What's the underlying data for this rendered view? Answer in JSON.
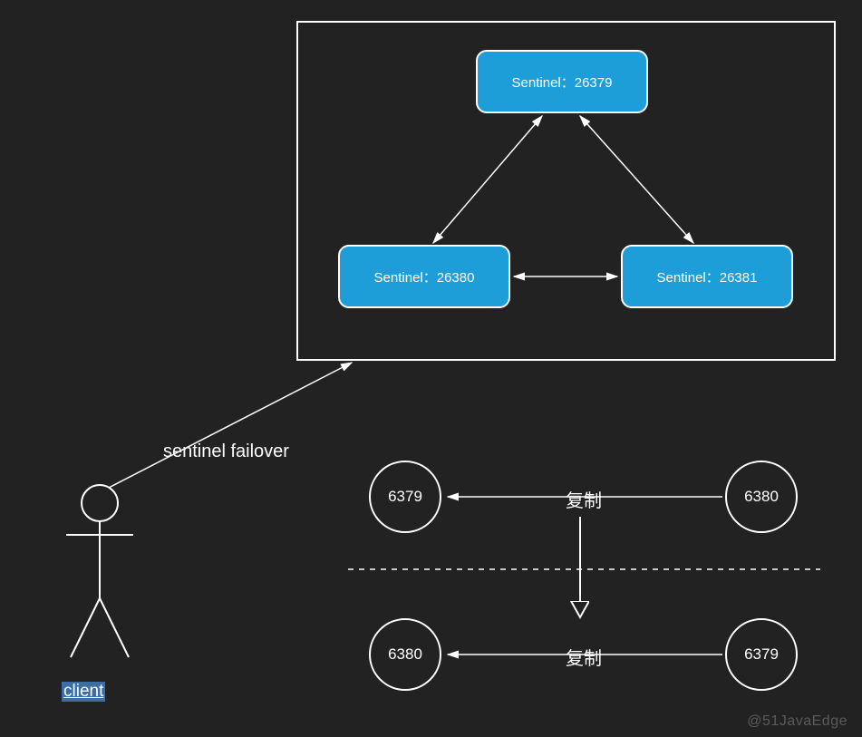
{
  "diagram": {
    "cluster_label": "",
    "sentinels": {
      "top": "Sentinel：26379",
      "left": "Sentinel：26380",
      "right": "Sentinel：26381"
    },
    "failover_label": "sentinel failover",
    "client_label": "client",
    "replication": {
      "before": {
        "master": "6379",
        "slave": "6380",
        "label": "复制"
      },
      "after": {
        "master": "6380",
        "slave": "6379",
        "label": "复制"
      }
    },
    "watermark": "@51JavaEdge"
  },
  "colors": {
    "node_fill": "#1e9ed8",
    "background": "#222222",
    "stroke": "#ffffff"
  }
}
